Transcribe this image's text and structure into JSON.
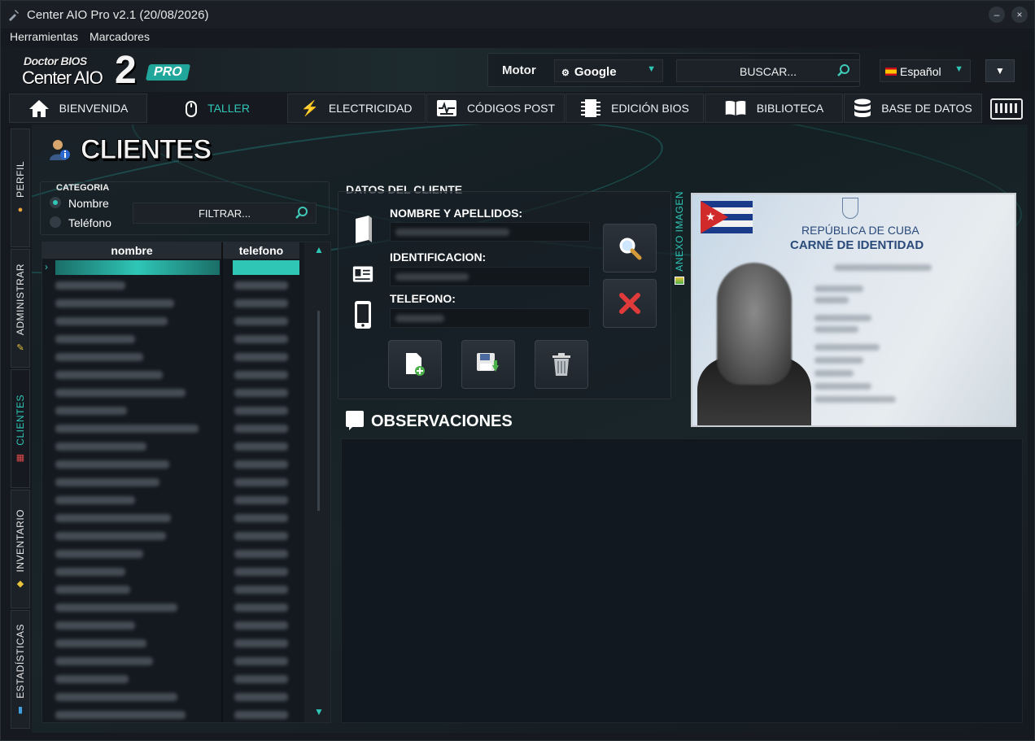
{
  "window": {
    "title": "Center AIO Pro v2.1 (20/08/2026)",
    "minimize_glyph": "–",
    "close_glyph": "×"
  },
  "menu": {
    "items": [
      "Herramientas",
      "Marcadores"
    ]
  },
  "logo": {
    "line1": "Doctor BIOS",
    "line2": "Center AIO",
    "big": "2",
    "badge": "PRO"
  },
  "header": {
    "motor_label": "Motor",
    "engine": "Google",
    "search_placeholder": "BUSCAR...",
    "language": "Español"
  },
  "nav": {
    "tabs": [
      {
        "label": "BIENVENIDA",
        "icon": "home-icon"
      },
      {
        "label": "TALLER",
        "icon": "mouse-icon"
      },
      {
        "label": "ELECTRICIDAD",
        "icon": "bolt-icon"
      },
      {
        "label": "CÓDIGOS POST",
        "icon": "post-card-icon"
      },
      {
        "label": "EDICIÓN BIOS",
        "icon": "chip-icon"
      },
      {
        "label": "BIBLIOTECA",
        "icon": "book-icon"
      },
      {
        "label": "BASE DE DATOS",
        "icon": "database-icon"
      }
    ],
    "active": "TALLER"
  },
  "side_tabs": [
    "PERFIL",
    "ADMINISTRAR",
    "CLIENTES",
    "INVENTARIO",
    "ESTADÍSTICAS"
  ],
  "page": {
    "title": "CLIENTES"
  },
  "category": {
    "label": "CATEGORIA",
    "options": [
      "Nombre",
      "Teléfono"
    ],
    "selected": "Nombre",
    "filter_placeholder": "FILTRAR..."
  },
  "grid": {
    "columns": [
      "nombre",
      "telefono"
    ],
    "row_count": 26
  },
  "client_form": {
    "section_label": "DATOS DEL CLIENTE",
    "name_label": "NOMBRE Y APELLIDOS:",
    "id_label": "IDENTIFICACION:",
    "phone_label": "TELEFONO:"
  },
  "attachment": {
    "tab_label": "ANEXO IMAGEN",
    "card_republic": "REPÚBLICA DE CUBA",
    "card_title": "CARNÉ DE IDENTIDAD"
  },
  "observations": {
    "label": "OBSERVACIONES"
  },
  "colors": {
    "accent": "#2fc6b6",
    "background": "#161a20",
    "panel": "#1c2128"
  }
}
